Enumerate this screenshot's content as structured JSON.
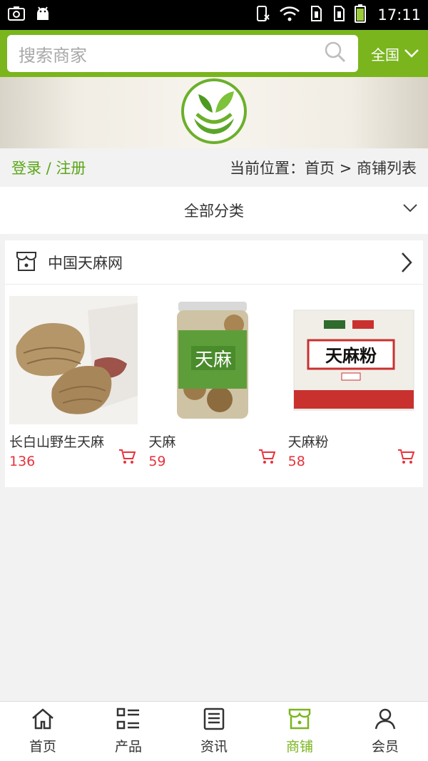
{
  "status_bar": {
    "time": "17:11"
  },
  "header": {
    "search_placeholder": "搜索商家",
    "region": "全国"
  },
  "breadcrumb": {
    "login": "登录 / 注册",
    "location": "当前位置：首页 > 商铺列表"
  },
  "filter": {
    "label": "全部分类"
  },
  "shop": {
    "name": "中国天麻网",
    "products": [
      {
        "name": "长白山野生天麻",
        "price": "136"
      },
      {
        "name": "天麻",
        "price": "59"
      },
      {
        "name": "天麻粉",
        "price": "58"
      }
    ]
  },
  "bottom_nav": {
    "items": [
      {
        "label": "首页",
        "icon": "home-icon"
      },
      {
        "label": "产品",
        "icon": "list-icon"
      },
      {
        "label": "资讯",
        "icon": "news-icon"
      },
      {
        "label": "商铺",
        "icon": "store-icon"
      },
      {
        "label": "会员",
        "icon": "user-icon"
      }
    ],
    "active": "商铺"
  },
  "colors": {
    "brand": "#7ab51d",
    "price": "#e8323c",
    "link": "#5ba619"
  },
  "product_image_texts": {
    "box_title": "天麻粉",
    "jar_label": "天麻"
  }
}
